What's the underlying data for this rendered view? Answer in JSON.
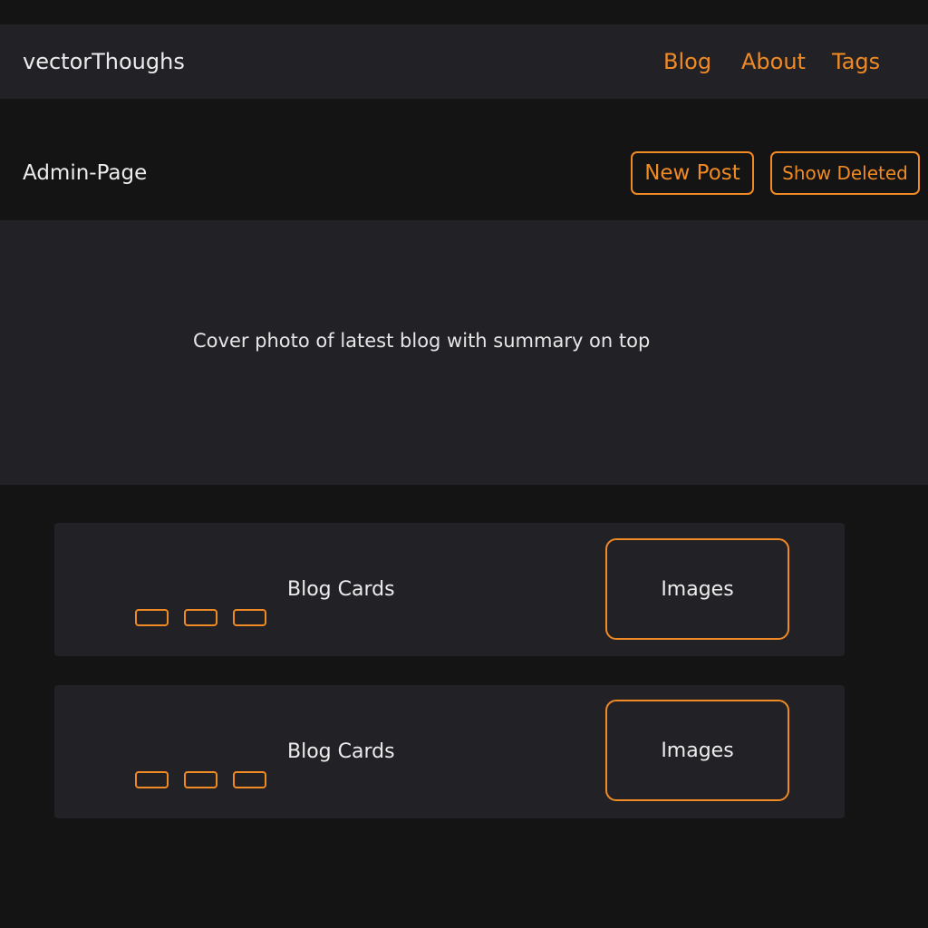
{
  "navbar": {
    "brand": "vectorThoughs",
    "links": [
      "Blog",
      "About",
      "Tags"
    ]
  },
  "admin": {
    "title": "Admin-Page",
    "new_post_label": "New Post",
    "show_deleted_label": "Show Deleted"
  },
  "hero": {
    "text": "Cover photo of latest blog with summary on top"
  },
  "cards": [
    {
      "title": "Blog Cards",
      "image_label": "Images"
    },
    {
      "title": "Blog Cards",
      "image_label": "Images"
    }
  ],
  "colors": {
    "accent": "#f08a24",
    "background": "#141415",
    "surface": "#222125",
    "text": "#ececec"
  }
}
